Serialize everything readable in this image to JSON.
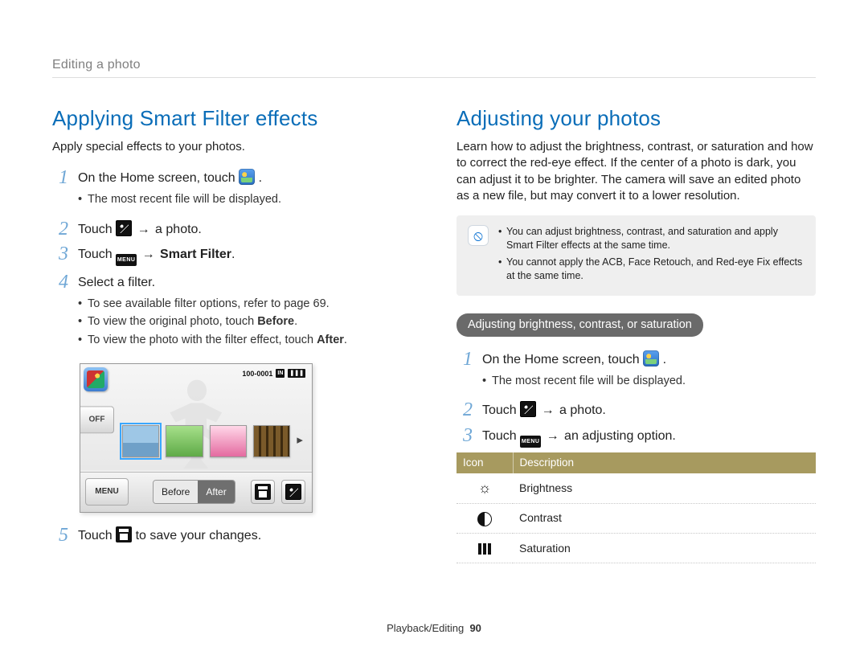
{
  "section_title": "Editing a photo",
  "left": {
    "heading": "Applying Smart Filter effects",
    "intro": "Apply special effects to your photos.",
    "steps": {
      "s1_a": "On the Home screen, touch ",
      "s1_b": ".",
      "s1_sub1": "The most recent file will be displayed.",
      "s2_a": "Touch ",
      "s2_arrow": "→",
      "s2_b": " a photo.",
      "s3_a": "Touch ",
      "s3_arrow": "→",
      "s3_b": "Smart Filter",
      "s3_c": ".",
      "s4": "Select a filter.",
      "s4_sub1": "To see available filter options, refer to page 69.",
      "s4_sub2_a": "To view the original photo, touch ",
      "s4_sub2_b": "Before",
      "s4_sub2_c": ".",
      "s4_sub3_a": "To view the photo with the filter effect, touch ",
      "s4_sub3_b": "After",
      "s4_sub3_c": ".",
      "s5_a": "Touch ",
      "s5_b": " to save your changes."
    },
    "camera": {
      "off": "OFF",
      "menu": "MENU",
      "counter": "100-0001",
      "badge1": "IN",
      "badge2": "❚❚❚",
      "before": "Before",
      "after": "After"
    }
  },
  "right": {
    "heading": "Adjusting your photos",
    "intro": "Learn how to adjust the brightness, contrast, or saturation and how to correct the red-eye effect. If the center of a photo is dark, you can adjust it to be brighter. The camera will save an edited photo as a new file, but may convert it to a lower resolution.",
    "notes": {
      "n1": "You can adjust brightness, contrast, and saturation and apply Smart Filter effects at the same time.",
      "n2": "You cannot apply the ACB, Face Retouch, and Red-eye Fix effects at the same time."
    },
    "pill": "Adjusting brightness, contrast, or saturation",
    "steps": {
      "s1_a": "On the Home screen, touch ",
      "s1_b": ".",
      "s1_sub1": "The most recent file will be displayed.",
      "s2_a": "Touch ",
      "s2_arrow": "→",
      "s2_b": " a photo.",
      "s3_a": "Touch ",
      "s3_arrow": "→",
      "s3_b": " an adjusting option."
    },
    "table": {
      "h1": "Icon",
      "h2": "Description",
      "r1": "Brightness",
      "r2": "Contrast",
      "r3": "Saturation"
    }
  },
  "footer": {
    "label": "Playback/Editing",
    "page": "90"
  }
}
